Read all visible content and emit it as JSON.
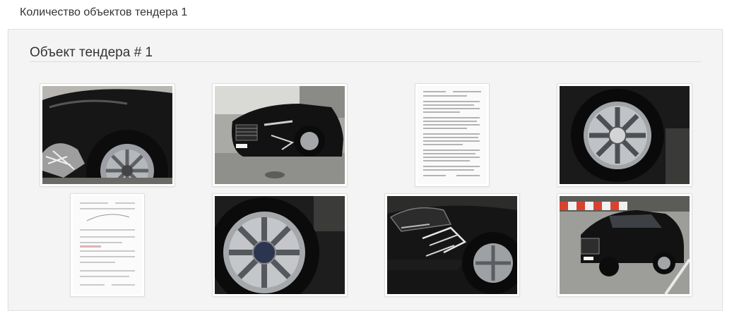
{
  "header": {
    "title": "Количество объектов тендера 1"
  },
  "panel": {
    "title": "Объект тендера # 1",
    "photos": [
      {
        "kind": "damaged-front-wheel-photo"
      },
      {
        "kind": "car-front-view-photo"
      },
      {
        "kind": "document-scan-1"
      },
      {
        "kind": "wheel-closeup-photo"
      },
      {
        "kind": "document-scan-2"
      },
      {
        "kind": "wheel-closeup-photo-2"
      },
      {
        "kind": "damaged-bumper-photo"
      },
      {
        "kind": "car-parking-view-photo"
      }
    ]
  },
  "colors": {
    "panel_bg": "#f4f4f4",
    "text": "#333333",
    "car_paint": "#141414"
  }
}
